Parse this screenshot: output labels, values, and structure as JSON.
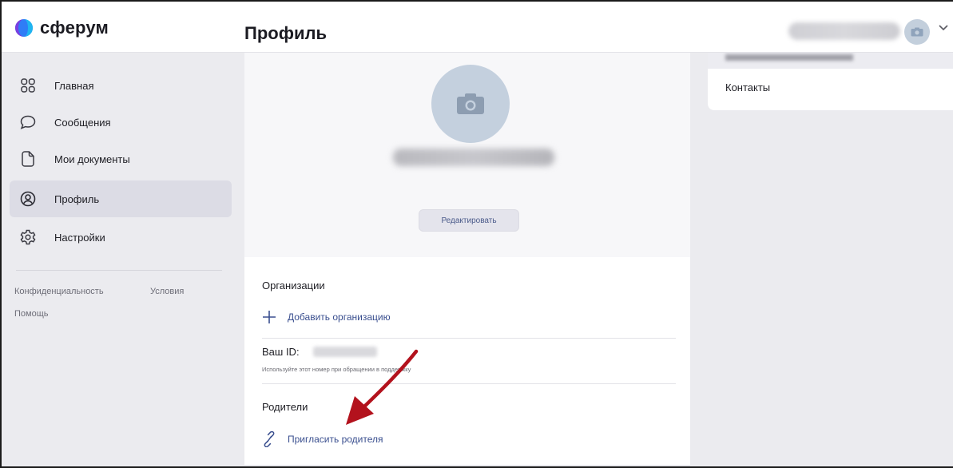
{
  "app": {
    "name": "сферум",
    "brand_color": "#6b3fd8",
    "accent_color": "#3a4f8f"
  },
  "header": {
    "page_title": "Профиль"
  },
  "sidebar": {
    "items": [
      {
        "label": "Главная",
        "icon": "grid-icon"
      },
      {
        "label": "Сообщения",
        "icon": "chat-bubble-icon"
      },
      {
        "label": "Мои документы",
        "icon": "document-icon"
      },
      {
        "label": "Профиль",
        "icon": "profile-icon",
        "active": true
      },
      {
        "label": "Настройки",
        "icon": "gear-icon"
      }
    ],
    "footer": {
      "privacy": "Конфиденциальность",
      "terms": "Условия",
      "help": "Помощь"
    }
  },
  "profile": {
    "edit_label": "Редактировать",
    "organizations_title": "Организации",
    "add_org_label": "Добавить организацию",
    "id_label": "Ваш ID:",
    "id_hint": "Используйте этот номер при обращении в поддержку",
    "parents_title": "Родители",
    "invite_parent_label": "Пригласить родителя"
  },
  "right_panel": {
    "contacts_label": "Контакты"
  },
  "annotation": {
    "arrow_color": "#b3121d"
  }
}
